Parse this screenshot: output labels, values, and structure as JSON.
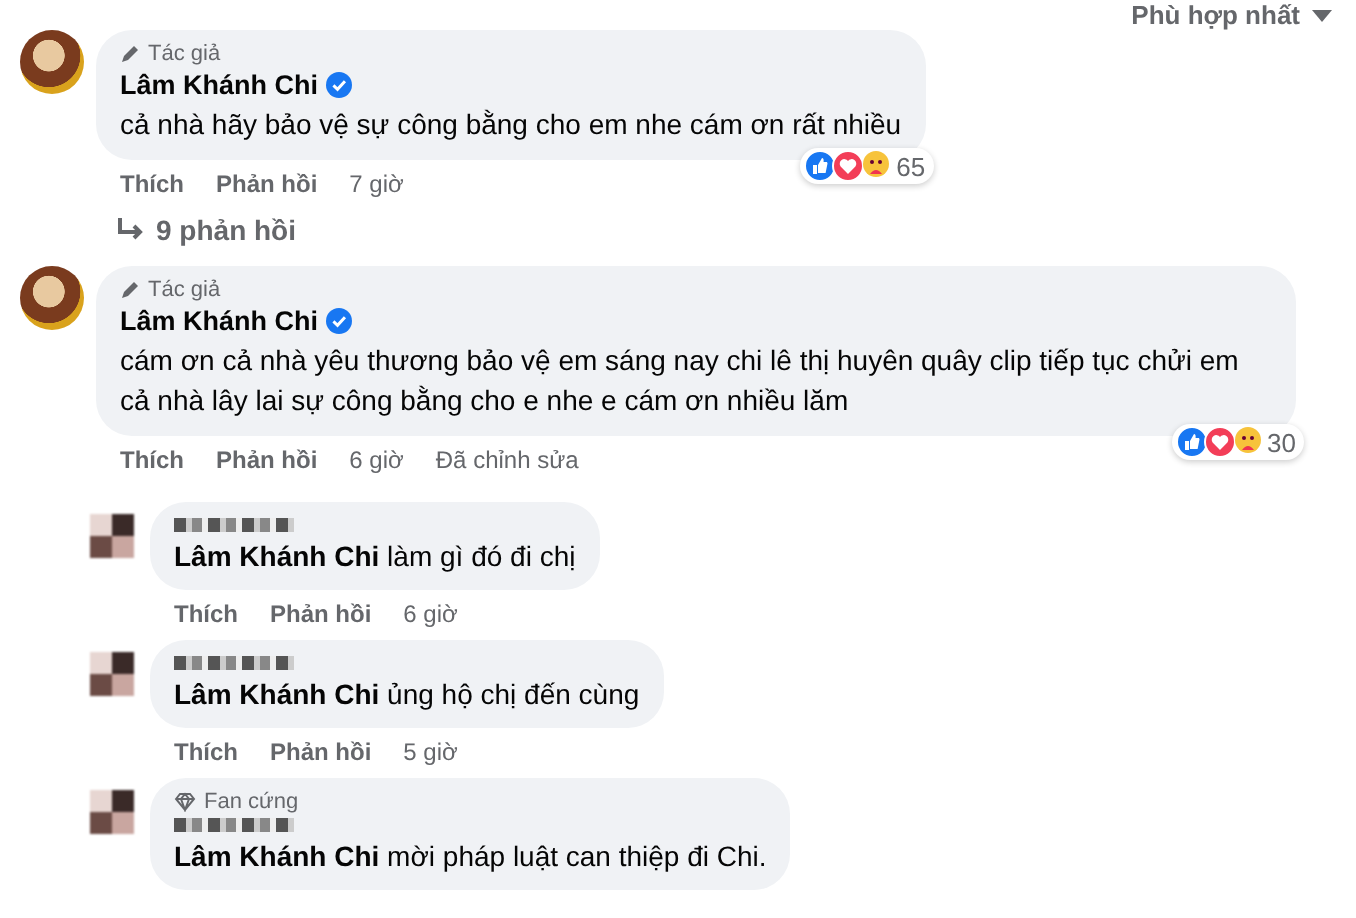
{
  "sort_menu": {
    "label": "Phù hợp nhất"
  },
  "comments": [
    {
      "badge": {
        "kind": "author",
        "label": "Tác giả"
      },
      "name": "Lâm Khánh Chi",
      "verified": true,
      "text": "cả nhà hãy bảo vệ sự công bằng cho em nhe cám ơn rất nhiều",
      "reaction_count": "65",
      "actions": [
        "Thích",
        "Phản hồi"
      ],
      "time": "7 giờ",
      "replies_link": "9 phản hồi"
    },
    {
      "badge": {
        "kind": "author",
        "label": "Tác giả"
      },
      "name": "Lâm Khánh Chi",
      "verified": true,
      "text": "cám ơn cả nhà yêu thương bảo vệ em sáng nay chi lê thị huyên quây clip tiếp tục chửi em cả nhà lây lai sự công bằng cho e nhe e cám ơn nhiều lăm",
      "reaction_count": "30",
      "actions": [
        "Thích",
        "Phản hồi"
      ],
      "time": "6 giờ",
      "edited": "Đã chỉnh sửa",
      "replies": [
        {
          "text": "**Lâm Khánh Chi** làm gì đó đi chị",
          "actions": [
            "Thích",
            "Phản hồi"
          ],
          "time": "6 giờ"
        },
        {
          "text": "**Lâm Khánh Chi** ủng hộ chị đến cùng",
          "actions": [
            "Thích",
            "Phản hồi"
          ],
          "time": "5 giờ"
        },
        {
          "badge": {
            "kind": "fan",
            "label": "Fan cứng"
          },
          "text": "**Lâm Khánh Chi** mời pháp luật can thiệp đi Chi."
        }
      ]
    }
  ]
}
